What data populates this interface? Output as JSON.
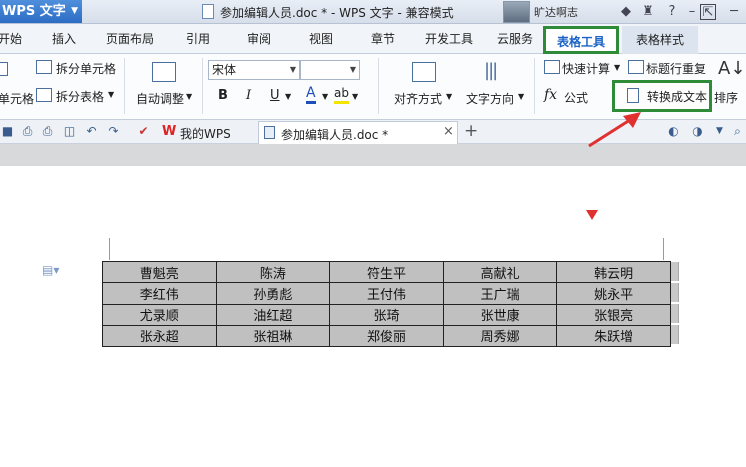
{
  "app": {
    "menu_label": "WPS 文字",
    "window_title": "参加编辑人员.doc * - WPS 文字 - 兼容模式",
    "user_name": "旷达啊志"
  },
  "ribbon_tabs": [
    "开始",
    "插入",
    "页面布局",
    "引用",
    "审阅",
    "视图",
    "章节",
    "开发工具",
    "云服务",
    "表格工具",
    "表格样式"
  ],
  "ribbon": {
    "split_cells": "拆分单元格",
    "merge_cells": "单元格",
    "split_table": "拆分表格",
    "auto_fit": "自动调整",
    "font_name": "宋体",
    "font_size": "",
    "bold": "B",
    "italic": "I",
    "underline": "U",
    "font_color": "A",
    "highlight": "ab",
    "align": "对齐方式",
    "text_direction": "文字方向",
    "quick_calc": "快速计算",
    "repeat_header": "标题行重复",
    "formula": "公式",
    "convert_to_text": "转换成文本",
    "sort": "排序"
  },
  "doc_tabs": {
    "my_wps": "我的WPS",
    "active_doc": "参加编辑人员.doc *",
    "add": "+"
  },
  "table": [
    [
      "曹魁亮",
      "陈涛",
      "符生平",
      "高献礼",
      "韩云明"
    ],
    [
      "李红伟",
      "孙勇彪",
      "王付伟",
      "王广瑞",
      "姚永平"
    ],
    [
      "尤录顺",
      "油红超",
      "张琦",
      "张世康",
      "张银亮"
    ],
    [
      "张永超",
      "张祖琳",
      "郑俊丽",
      "周秀娜",
      "朱跃增"
    ]
  ],
  "colors": {
    "highlight_box": "#2e8b37",
    "arrow": "#e03030",
    "table_bg": "#c0c0c0",
    "active_tab_text": "#1b63c6"
  },
  "icons": [
    "dropdown-icon",
    "document-icon",
    "avatar",
    "skin-icon",
    "help-icon",
    "minimize-icon",
    "save-icon",
    "print-icon",
    "undo-icon",
    "redo-icon",
    "close-icon",
    "formula-icon",
    "convert-text-icon",
    "sort-icon",
    "paragraph-icon"
  ]
}
